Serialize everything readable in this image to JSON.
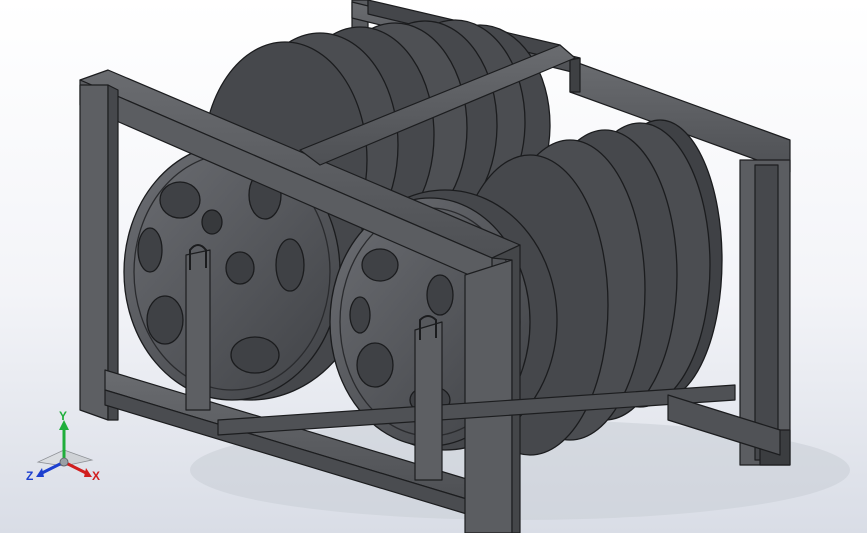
{
  "viewport": {
    "background_top": "#ffffff",
    "background_bottom": "#d9dde6"
  },
  "model": {
    "frame_color": "#55575b",
    "frame_edge": "#1c1d1f",
    "reel_color": "#4b4d51"
  },
  "triad": {
    "x_label": "X",
    "y_label": "Y",
    "z_label": "Z",
    "x_color": "#d11e1e",
    "y_color": "#1fae3b",
    "z_color": "#1c3fcf"
  }
}
